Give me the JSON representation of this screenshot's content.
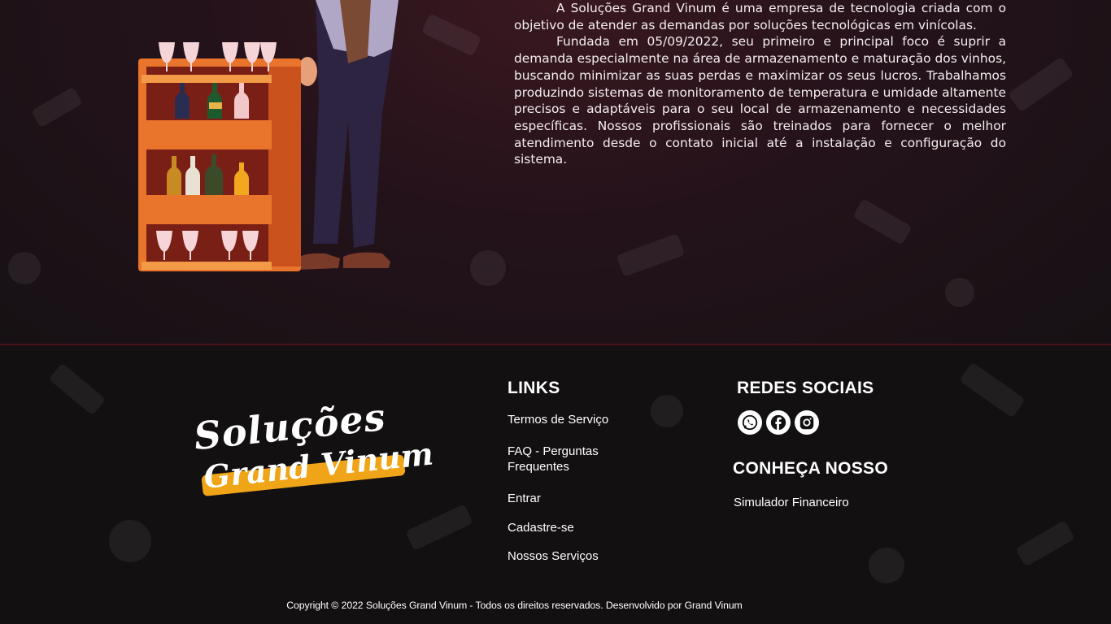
{
  "about": {
    "paragraph1": "A Soluções Grand Vinum é uma empresa de tecnologia criada com o objetivo de atender as demandas por soluções tecnológicas em vinícolas.",
    "paragraph2": "Fundada em 05/09/2022, seu primeiro e principal foco é suprir a demanda especialmente na área de armazenamento e maturação dos vinhos, buscando minimizar as suas perdas e maximizar os seus lucros. Trabalhamos produzindo sistemas de monitoramento de temperatura e umidade altamente precisos e adaptáveis para o seu local de armazenamento e necessidades específicas. Nossos profissionais são treinados para fornecer o melhor atendimento desde o contato inicial até a instalação e configuração do sistema."
  },
  "footer": {
    "logo": {
      "line1": "Soluções",
      "line2": "Grand Vinum"
    },
    "links": {
      "heading": "LINKS",
      "items": [
        "Termos de Serviço",
        "FAQ - Perguntas Frequentes",
        "Entrar",
        "Cadastre-se",
        "Nossos Serviços"
      ]
    },
    "social": {
      "heading": "REDES SOCIAIS",
      "icons": [
        "whatsapp-icon",
        "facebook-icon",
        "instagram-icon"
      ]
    },
    "know": {
      "heading": "CONHEÇA NOSSO",
      "items": [
        "Simulador Financeiro"
      ]
    },
    "copyright": "Copyright © 2022 Soluções Grand Vinum - Todos os direitos reservados. Desenvolvido por Grand Vinum"
  },
  "colors": {
    "accent": "#f0a417",
    "divider": "#4a1018",
    "shelf": "#e9742b"
  }
}
